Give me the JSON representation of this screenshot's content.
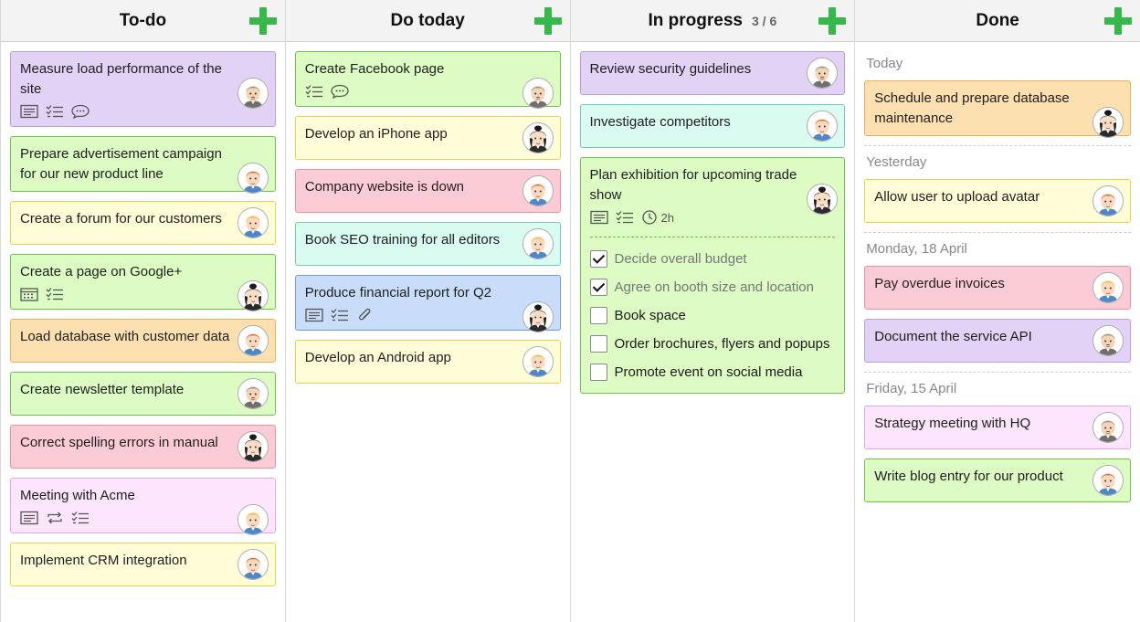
{
  "columns": [
    {
      "title": "To-do",
      "count": "",
      "cards": [
        {
          "title": "Measure load performance of the site",
          "color": "purple",
          "avatar": "man-gray",
          "icons": [
            "notes-icon",
            "checklist-icon",
            "comment-icon"
          ]
        },
        {
          "title": "Prepare advertisement campaign for our new product line",
          "color": "green",
          "avatar": "man-red",
          "icons": []
        },
        {
          "title": "Create a forum for our customers",
          "color": "yellow",
          "avatar": "man-blond",
          "icons": []
        },
        {
          "title": "Create a page on Google+",
          "color": "green",
          "avatar": "woman-dark",
          "icons": [
            "calendar-icon",
            "checklist-icon"
          ]
        },
        {
          "title": "Load database with customer data",
          "color": "orange",
          "avatar": "man-red",
          "icons": []
        },
        {
          "title": "Create newsletter template",
          "color": "green",
          "avatar": "man-gray",
          "icons": []
        },
        {
          "title": "Correct spelling errors in manual",
          "color": "red",
          "avatar": "woman-dark",
          "icons": []
        },
        {
          "title": "Meeting with Acme",
          "color": "pink",
          "avatar": "man-blond",
          "icons": [
            "notes-icon",
            "repeat-icon",
            "checklist-icon"
          ]
        },
        {
          "title": "Implement CRM integration",
          "color": "yellow",
          "avatar": "man-red",
          "icons": []
        }
      ]
    },
    {
      "title": "Do today",
      "count": "",
      "cards": [
        {
          "title": "Create Facebook page",
          "color": "green",
          "avatar": "man-gray",
          "icons": [
            "checklist-icon",
            "comment-icon"
          ]
        },
        {
          "title": "Develop an iPhone app",
          "color": "yellow",
          "avatar": "woman-dark",
          "icons": []
        },
        {
          "title": "Company website is down",
          "color": "red",
          "avatar": "man-red",
          "icons": []
        },
        {
          "title": "Book SEO training for all editors",
          "color": "teal",
          "avatar": "man-blond",
          "icons": []
        },
        {
          "title": "Produce financial report for Q2",
          "color": "blue",
          "avatar": "woman-dark",
          "icons": [
            "notes-icon",
            "checklist-icon",
            "attachment-icon"
          ]
        },
        {
          "title": "Develop an Android app",
          "color": "yellow",
          "avatar": "man-blond",
          "icons": []
        }
      ]
    },
    {
      "title": "In progress",
      "count": "3 / 6",
      "cards": [
        {
          "title": "Review security guidelines",
          "color": "purple",
          "avatar": "man-gray",
          "icons": []
        },
        {
          "title": "Investigate competitors",
          "color": "teal",
          "avatar": "man-red",
          "icons": []
        },
        {
          "title": "Plan exhibition for upcoming trade show",
          "color": "green",
          "avatar": "woman-dark",
          "icons": [
            "notes-icon",
            "checklist-icon",
            "clock-icon"
          ],
          "time": "2h",
          "checklist": [
            {
              "label": "Decide overall budget",
              "checked": true
            },
            {
              "label": "Agree on booth size and location",
              "checked": true
            },
            {
              "label": "Book space",
              "checked": false
            },
            {
              "label": "Order brochures, flyers and popups",
              "checked": false
            },
            {
              "label": "Promote event on social media",
              "checked": false
            }
          ]
        }
      ]
    },
    {
      "title": "Done",
      "count": "",
      "groups": [
        {
          "label": "Today",
          "cards": [
            {
              "title": "Schedule and prepare database maintenance",
              "color": "orange",
              "avatar": "woman-dark",
              "icons": []
            }
          ]
        },
        {
          "label": "Yesterday",
          "cards": [
            {
              "title": "Allow user to upload avatar",
              "color": "yellow",
              "avatar": "man-red",
              "icons": []
            }
          ]
        },
        {
          "label": "Monday, 18 April",
          "cards": [
            {
              "title": "Pay overdue invoices",
              "color": "red",
              "avatar": "man-blond",
              "icons": []
            },
            {
              "title": "Document the service API",
              "color": "purple",
              "avatar": "man-gray",
              "icons": []
            }
          ]
        },
        {
          "label": "Friday, 15 April",
          "cards": [
            {
              "title": "Strategy meeting with HQ",
              "color": "pink",
              "avatar": "man-gray",
              "icons": []
            },
            {
              "title": "Write blog entry for our product",
              "color": "green",
              "avatar": "man-red",
              "icons": []
            }
          ]
        }
      ]
    }
  ],
  "colors": {
    "add": "#36b84a",
    "purple": "#e2d2f5",
    "green": "#dcfcc3",
    "yellow": "#fefdd8",
    "orange": "#fde0b0",
    "red": "#fcccd6",
    "pink": "#fde5fd",
    "teal": "#d9fbf0",
    "blue": "#c9ddfa"
  }
}
